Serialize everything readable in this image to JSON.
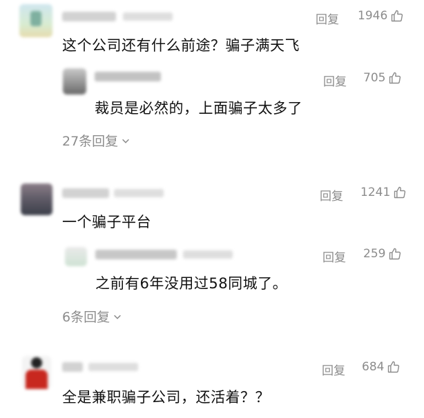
{
  "comments": [
    {
      "reply_label": "回复",
      "likes": "1946",
      "text": "这个公司还有什么前途？骗子满天飞",
      "sub_reply": {
        "reply_label": "回复",
        "likes": "705",
        "text": "裁员是必然的，上面骗子太多了"
      },
      "expand_label": "27条回复"
    },
    {
      "reply_label": "回复",
      "likes": "1241",
      "text": "一个骗子平台",
      "sub_reply": {
        "reply_label": "回复",
        "likes": "259",
        "text": "之前有6年没用过58同城了。"
      },
      "expand_label": "6条回复"
    },
    {
      "reply_label": "回复",
      "likes": "684",
      "text": "全是兼职骗子公司，还活着？？"
    }
  ],
  "icons": {
    "like": "thumb-up-icon",
    "expand": "chevron-down-icon"
  },
  "colors": {
    "text": "#111111",
    "muted": "#8c8c8c"
  }
}
